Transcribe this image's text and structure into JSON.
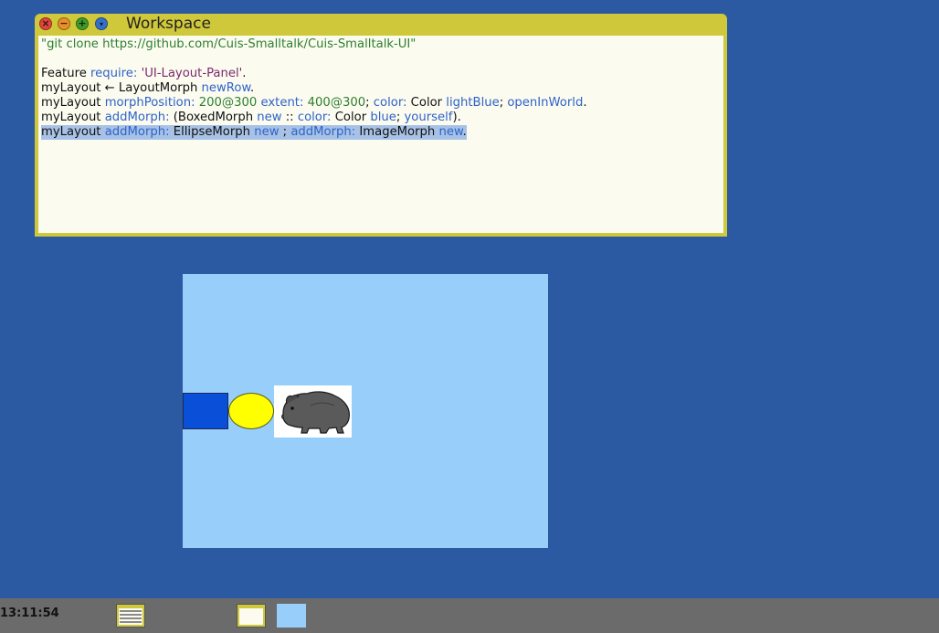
{
  "window": {
    "title": "Workspace",
    "buttons": {
      "close": "×",
      "minimize": "−",
      "maximize": "+",
      "menu": "▾"
    }
  },
  "code": {
    "line1": "\"git clone https://github.com/Cuis-Smalltalk/Cuis-Smalltalk-UI\"",
    "line3": {
      "a": "Feature ",
      "b": "require: ",
      "c": "'UI-Layout-Panel'",
      "d": "."
    },
    "line4": {
      "a": "myLayout ← LayoutMorph ",
      "b": "newRow",
      "c": "."
    },
    "line5": {
      "a": "myLayout ",
      "b": "morphPosition: ",
      "c": "200@300 ",
      "d": "extent: ",
      "e": "400@300",
      "f": "; ",
      "g": "color: ",
      "h": "Color ",
      "i": "lightBlue",
      "j": "; ",
      "k": "openInWorld",
      "l": "."
    },
    "line6": {
      "a": "myLayout ",
      "b": "addMorph: ",
      "c": "(BoxedMorph ",
      "d": "new ",
      "e": ":: ",
      "f": "color: ",
      "g": "Color ",
      "h": "blue",
      "i": "; ",
      "j": "yourself",
      "k": ")."
    },
    "line7": {
      "a": "myLayout ",
      "b": "addMorph: ",
      "c": "EllipseMorph ",
      "d": "new ",
      "e": "; ",
      "f": "addMorph: ",
      "g": "ImageMorph ",
      "h": "new",
      "i": "."
    }
  },
  "morphs": {
    "layout_color": "#97cffa",
    "boxed_color": "#0a4fd8",
    "ellipse_color": "#ffff00",
    "image": "capybara"
  },
  "taskbar": {
    "clock": "13:11:54"
  }
}
